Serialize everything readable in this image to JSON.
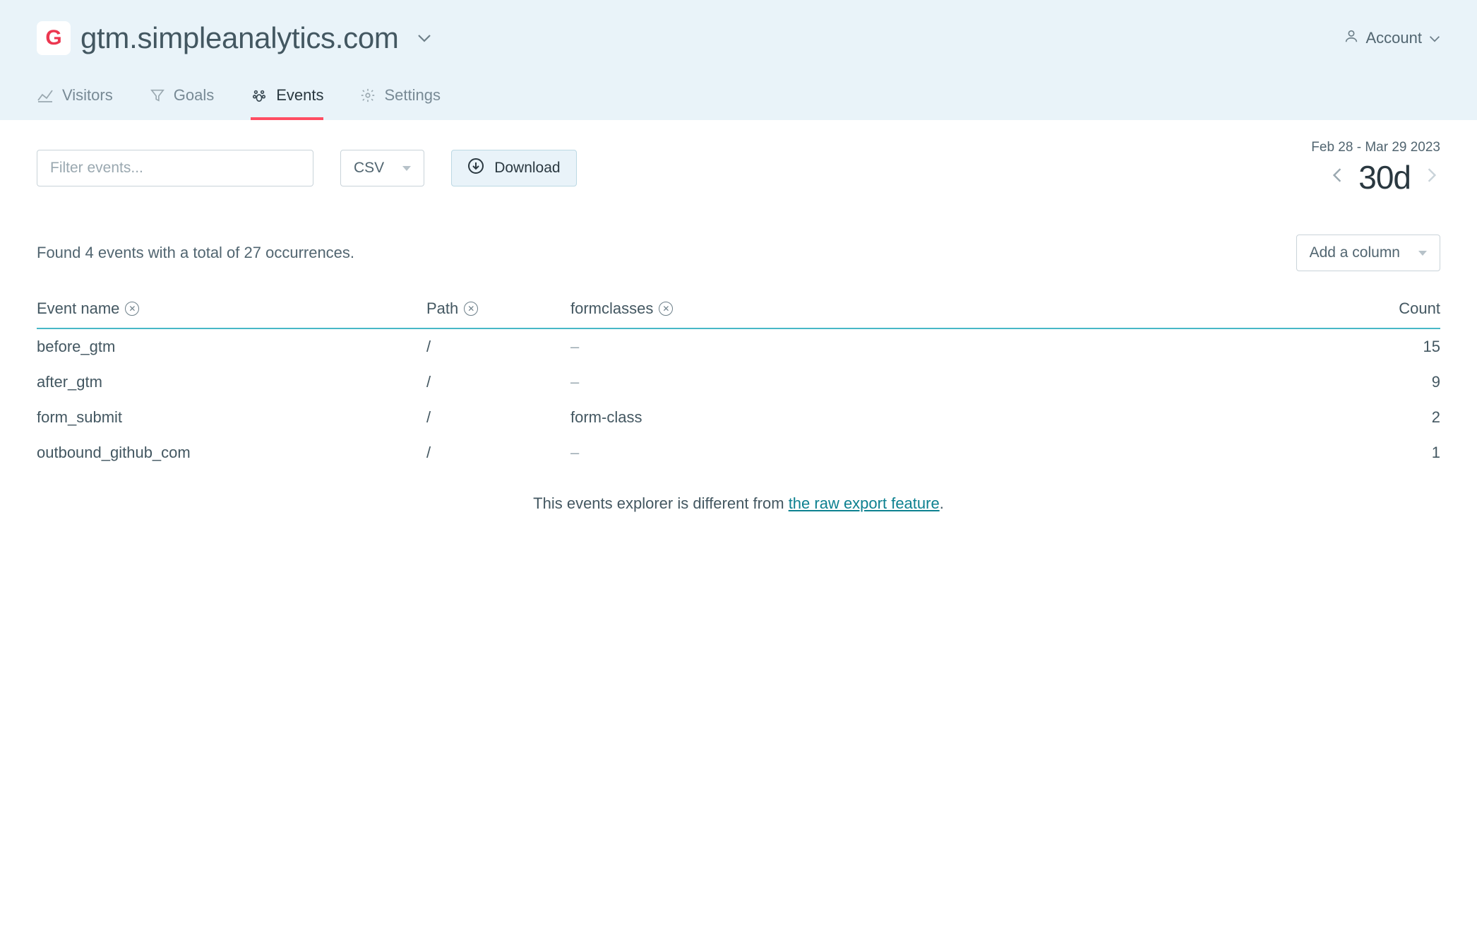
{
  "site": {
    "logo_letter": "G",
    "title": "gtm.simpleanalytics.com"
  },
  "account": {
    "label": "Account"
  },
  "tabs": {
    "visitors": "Visitors",
    "goals": "Goals",
    "events": "Events",
    "settings": "Settings"
  },
  "controls": {
    "filter_placeholder": "Filter events...",
    "format_selected": "CSV",
    "download_label": "Download",
    "date_range": "Feb 28 - Mar 29 2023",
    "period": "30d"
  },
  "summary": "Found 4 events with a total of 27 occurrences.",
  "add_column_label": "Add a column",
  "columns": {
    "name": "Event name",
    "path": "Path",
    "formclasses": "formclasses",
    "count": "Count"
  },
  "rows": [
    {
      "name": "before_gtm",
      "path": "/",
      "formclasses": "–",
      "count": "15"
    },
    {
      "name": "after_gtm",
      "path": "/",
      "formclasses": "–",
      "count": "9"
    },
    {
      "name": "form_submit",
      "path": "/",
      "formclasses": "form-class",
      "count": "2"
    },
    {
      "name": "outbound_github_com",
      "path": "/",
      "formclasses": "–",
      "count": "1"
    }
  ],
  "footer": {
    "prefix": "This events explorer is different from ",
    "link": "the raw export feature",
    "suffix": "."
  }
}
